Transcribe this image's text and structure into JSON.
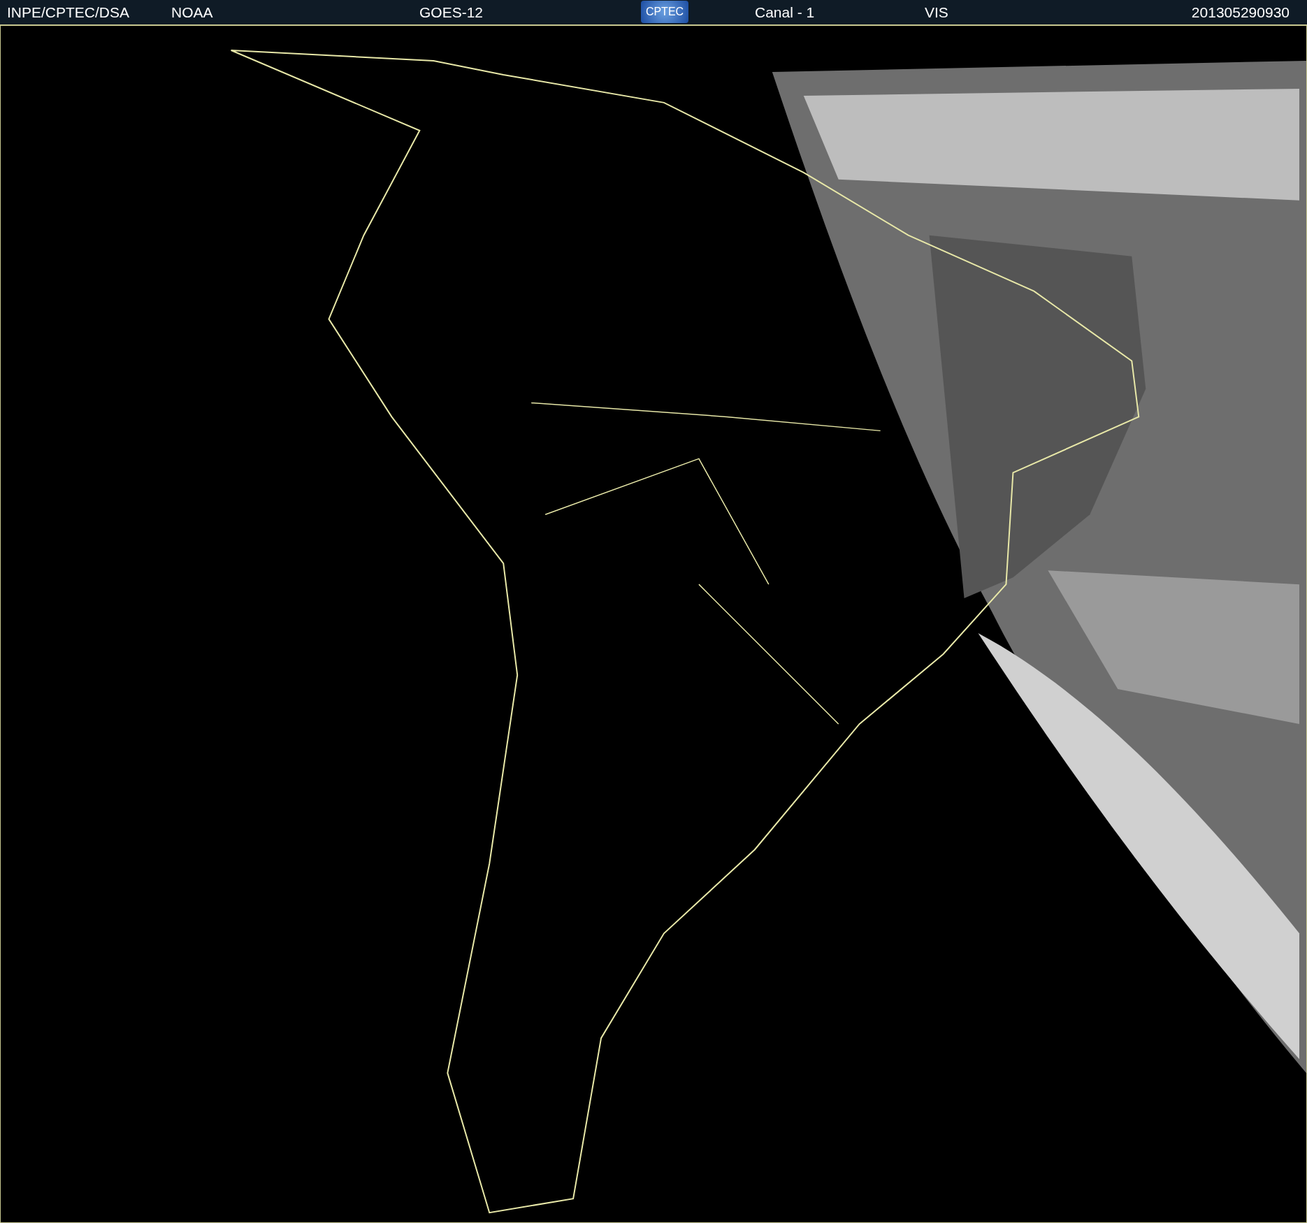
{
  "header": {
    "items": [
      {
        "kind": "text",
        "label": "INPE/CPTEC/DSA"
      },
      {
        "kind": "text",
        "label": "NOAA"
      },
      {
        "kind": "text",
        "label": "GOES-12"
      },
      {
        "kind": "logo",
        "label": "CPTEC"
      },
      {
        "kind": "text",
        "label": "Canal - 1"
      },
      {
        "kind": "text",
        "label": "VIS"
      },
      {
        "kind": "text",
        "label": "201305290930"
      }
    ]
  }
}
